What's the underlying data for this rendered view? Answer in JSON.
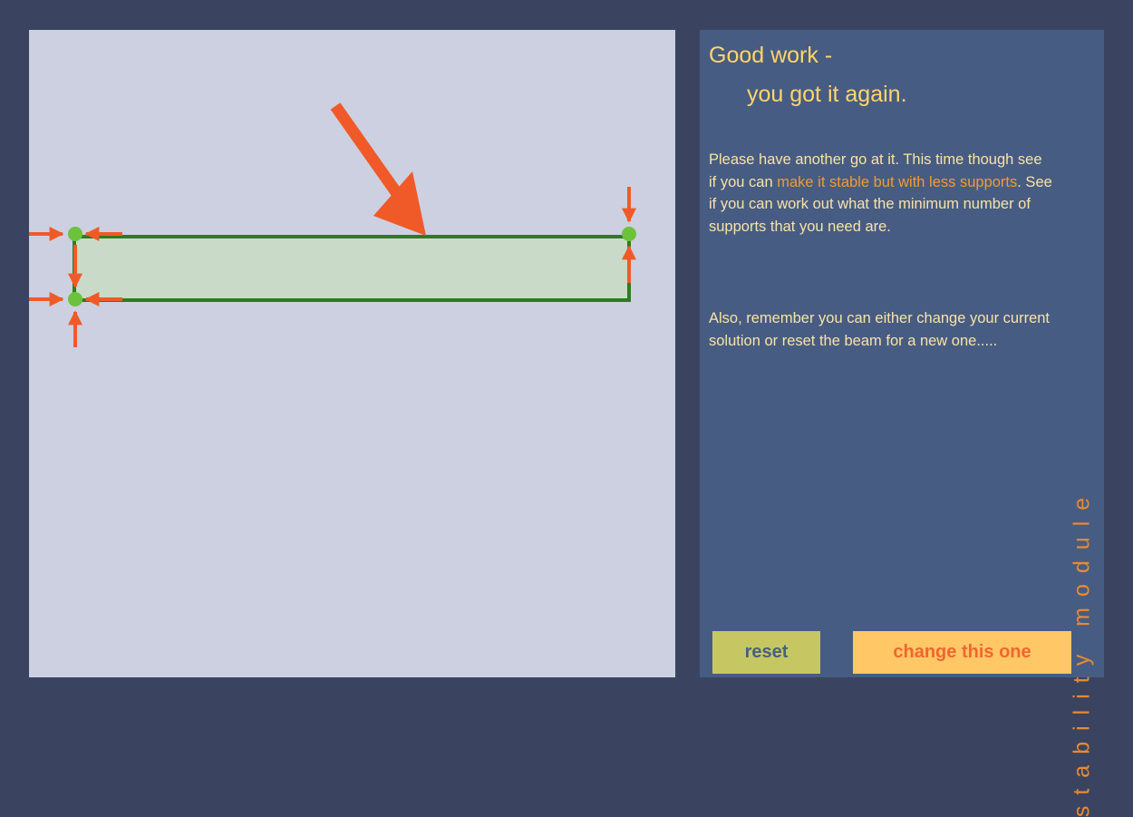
{
  "canvas": {
    "beam_fill": "#c9dbc8",
    "beam_stroke": "#2f7a23",
    "support_color": "#f05a28",
    "node_color": "#6cc23a",
    "background": "#cdd0e0"
  },
  "info": {
    "heading_line1": "Good work -",
    "heading_line2": "you got it again.",
    "paragraph1_before": "Please have another go at it.  This time though see if you can ",
    "paragraph1_highlight": "make it stable but with less supports",
    "paragraph1_after": ".  See if you can work out what the minimum number of supports that you need are.",
    "paragraph2": "Also, remember you can either change your current solution or reset the beam for a new one.....",
    "vertical_label": "stability module"
  },
  "buttons": {
    "reset_label": "reset",
    "change_label": "change this one"
  }
}
